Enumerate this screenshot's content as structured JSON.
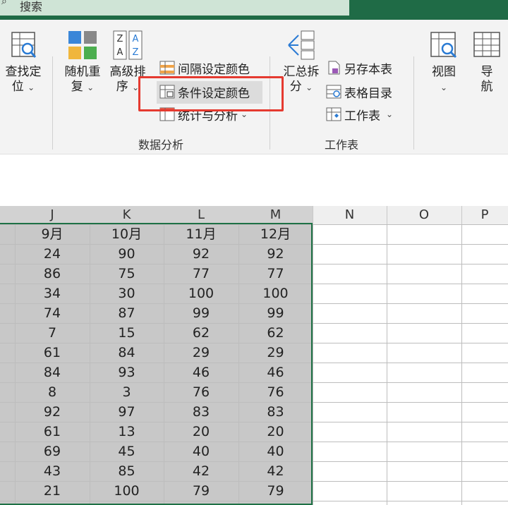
{
  "titlebar": {
    "search_label": "搜索"
  },
  "ribbon": {
    "find": {
      "line1": "查找定",
      "line2": "位"
    },
    "random": {
      "line1": "随机重",
      "line2": "复"
    },
    "advanced_sort": {
      "line1": "高级排",
      "line2": "序"
    },
    "interval_color": "间隔设定颜色",
    "condition_color": "条件设定颜色",
    "stats_analysis": "统计与分析",
    "summary_split": {
      "line1": "汇总拆",
      "line2": "分"
    },
    "save_as": "另存本表",
    "table_toc": "表格目录",
    "worksheet": "工作表",
    "view": {
      "line1": "视图"
    },
    "nav": {
      "line1": "导",
      "line2": "航"
    },
    "group_data_analysis": "数据分析",
    "group_worksheet": "工作表"
  },
  "columns": [
    "J",
    "K",
    "L",
    "M",
    "N",
    "O",
    "P"
  ],
  "table": {
    "headers": [
      "9月",
      "10月",
      "11月",
      "12月"
    ],
    "rows": [
      [
        "24",
        "90",
        "92",
        "92"
      ],
      [
        "86",
        "75",
        "77",
        "77"
      ],
      [
        "34",
        "30",
        "100",
        "100"
      ],
      [
        "74",
        "87",
        "99",
        "99"
      ],
      [
        "7",
        "15",
        "62",
        "62"
      ],
      [
        "61",
        "84",
        "29",
        "29"
      ],
      [
        "84",
        "93",
        "46",
        "46"
      ],
      [
        "8",
        "3",
        "76",
        "76"
      ],
      [
        "92",
        "97",
        "83",
        "83"
      ],
      [
        "61",
        "13",
        "20",
        "20"
      ],
      [
        "69",
        "45",
        "40",
        "40"
      ],
      [
        "43",
        "85",
        "42",
        "42"
      ],
      [
        "21",
        "100",
        "79",
        "79"
      ]
    ]
  },
  "colors": {
    "title_green": "#1f6b46",
    "selection_border": "#1e7145",
    "highlight_red": "#e53a30"
  }
}
